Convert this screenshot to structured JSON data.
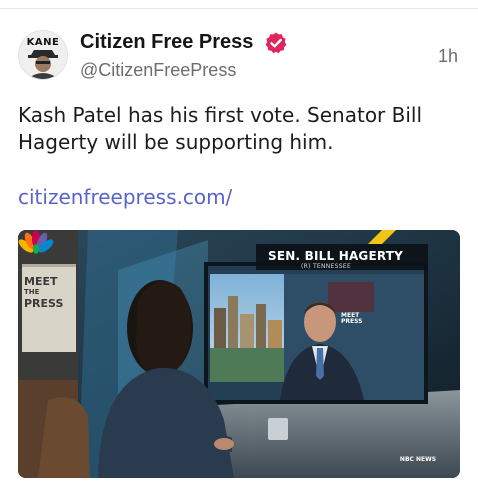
{
  "post": {
    "avatar_label": "KANE",
    "display_name": "Citizen Free Press",
    "verified_icon": "verified-badge-icon",
    "handle": "@CitizenFreePress",
    "timestamp": "1h",
    "text": "Kash Patel has his first vote. Senator Bill Hagerty will be supporting him.",
    "link_text": "citizenfreepress.com/"
  },
  "media": {
    "lower_third_name": "SEN. BILL HAGERTY",
    "lower_third_state": "(R) TENNESSEE",
    "set_logo_line1": "MEET",
    "set_logo_line2": "THE",
    "set_logo_line3": "PRESS",
    "inset_logo_line1": "MEET",
    "inset_logo_line2": "PRESS",
    "network_label": "NBC NEWS"
  },
  "colors": {
    "link": "#5864c8",
    "verified": "#e0245e",
    "muted_text": "#6d6d6d"
  }
}
